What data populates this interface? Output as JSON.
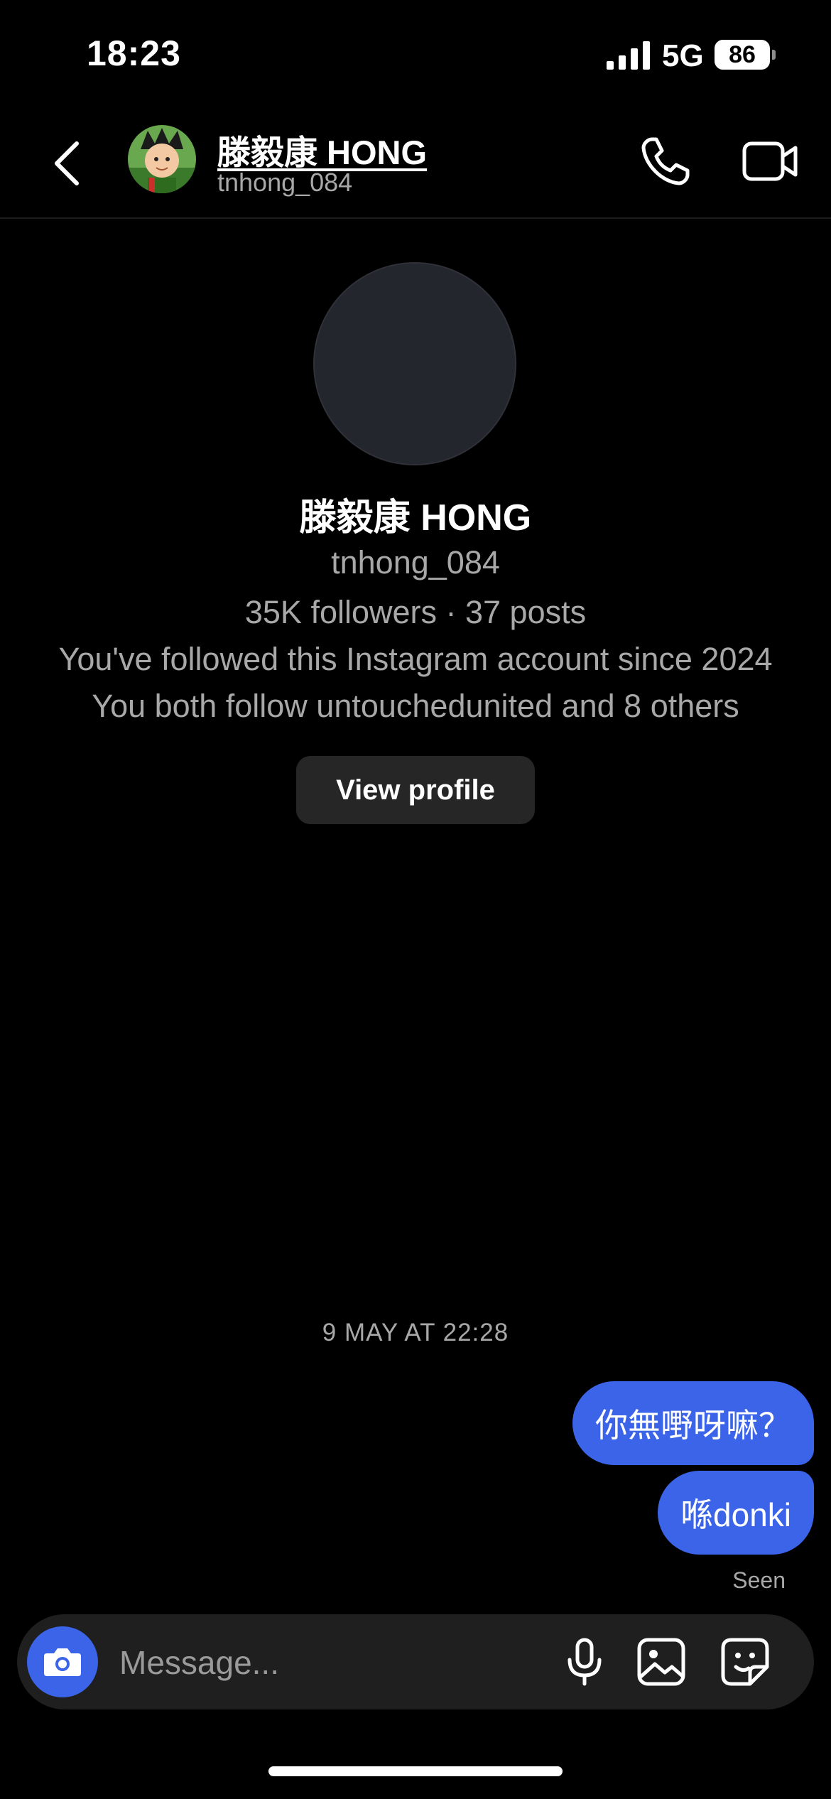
{
  "status_bar": {
    "time": "18:23",
    "network": "5G",
    "battery": "86"
  },
  "header": {
    "name": "滕毅康 HONG",
    "username": "tnhong_084"
  },
  "profile": {
    "name": "滕毅康 HONG",
    "username": "tnhong_084",
    "stats": "35K followers · 37 posts",
    "followed_since": "You've followed this Instagram account since 2024",
    "mutual": "You both follow untouchedunited and 8 others",
    "view_profile_label": "View profile"
  },
  "thread": {
    "timestamp": "9 MAY AT 22:28",
    "messages": [
      {
        "text": "你無嘢呀嘛？",
        "from": "me"
      },
      {
        "text": "喺donki",
        "from": "me"
      }
    ],
    "seen_label": "Seen"
  },
  "composer": {
    "placeholder": "Message..."
  },
  "colors": {
    "background": "#000000",
    "bubble": "#3b64e8",
    "secondary_text": "#a8a8a8",
    "button_bg": "#262626"
  }
}
